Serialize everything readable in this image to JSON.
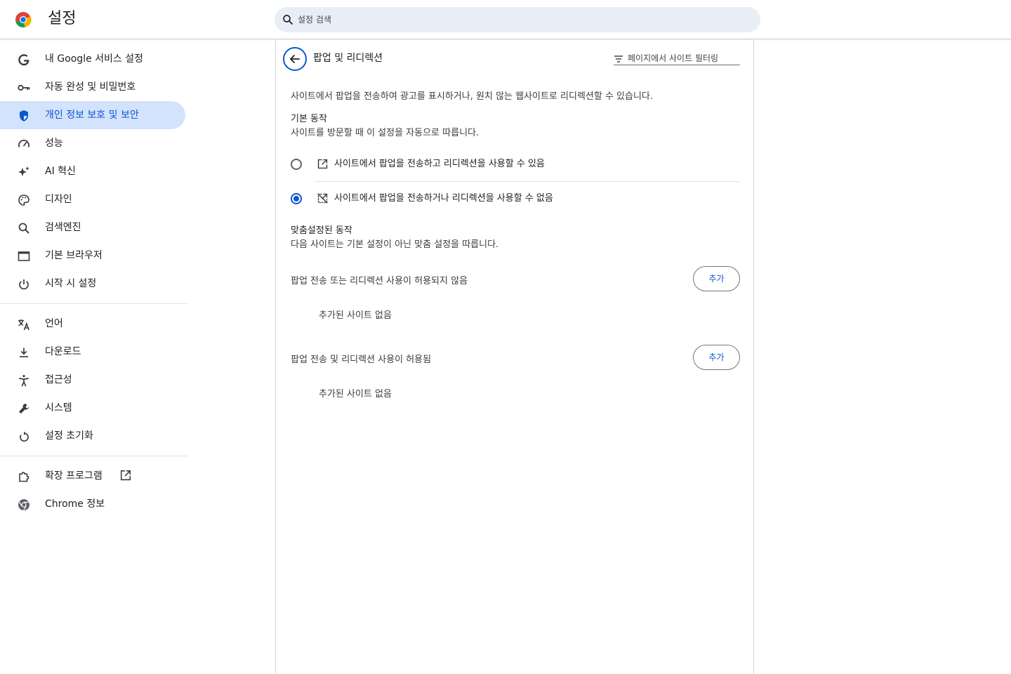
{
  "header": {
    "title": "설정",
    "search_placeholder": "설정 검색"
  },
  "sidebar": {
    "items": [
      {
        "label": "내 Google 서비스 설정",
        "icon": "google-g-icon"
      },
      {
        "label": "자동 완성 및 비밀번호",
        "icon": "key-icon"
      },
      {
        "label": "개인 정보 보호 및 보안",
        "icon": "shield-icon",
        "active": true
      },
      {
        "label": "성능",
        "icon": "speedometer-icon"
      },
      {
        "label": "AI 혁신",
        "icon": "sparkle-icon"
      },
      {
        "label": "디자인",
        "icon": "palette-icon"
      },
      {
        "label": "검색엔진",
        "icon": "search-icon"
      },
      {
        "label": "기본 브라우저",
        "icon": "browser-window-icon"
      },
      {
        "label": "시작 시 설정",
        "icon": "power-icon"
      },
      {
        "label": "언어",
        "icon": "translate-icon"
      },
      {
        "label": "다운로드",
        "icon": "download-icon"
      },
      {
        "label": "접근성",
        "icon": "accessibility-icon"
      },
      {
        "label": "시스템",
        "icon": "wrench-icon"
      },
      {
        "label": "설정 초기화",
        "icon": "reset-icon"
      },
      {
        "label": "확장 프로그램",
        "icon": "puzzle-icon"
      },
      {
        "label": "Chrome 정보",
        "icon": "chrome-icon"
      }
    ]
  },
  "main": {
    "title": "팝업 및 리디렉션",
    "filter_placeholder": "페이지에서 사이트 필터링",
    "description": "사이트에서 팝업을 전송하여 광고를 표시하거나, 원치 않는 웹사이트로 리디렉션할 수 있습니다.",
    "default_behavior": {
      "heading": "기본 동작",
      "subtext": "사이트를 방문할 때 이 설정을 자동으로 따릅니다.",
      "options": [
        {
          "label": "사이트에서 팝업을 전송하고 리디렉션을 사용할 수 있음",
          "icon": "open-in-new-icon",
          "checked": false
        },
        {
          "label": "사이트에서 팝업을 전송하거나 리디렉션을 사용할 수 없음",
          "icon": "open-in-new-off-icon",
          "checked": true
        }
      ]
    },
    "custom_behavior": {
      "heading": "맞춤설정된 동작",
      "subtext": "다음 사이트는 기본 설정이 아닌 맞춤 설정을 따릅니다."
    },
    "blocked_section": {
      "label": "팝업 전송 또는 리디렉션 사용이 허용되지 않음",
      "button": "추가",
      "empty": "추가된 사이트 없음"
    },
    "allowed_section": {
      "label": "팝업 전송 및 리디렉션 사용이 허용됨",
      "button": "추가",
      "empty": "추가된 사이트 없음"
    }
  }
}
